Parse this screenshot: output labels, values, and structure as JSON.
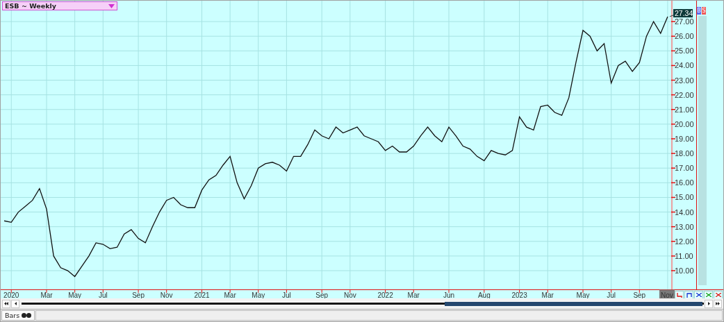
{
  "chart_header": {
    "title": "ESB ~ Weekly"
  },
  "chart": {
    "last_price": "27.34",
    "chart_data": {
      "type": "line",
      "grid": true,
      "ylim": [
        8.77,
        28.33
      ],
      "categories": [
        null,
        "2020",
        null,
        null,
        null,
        null,
        "Mar",
        null,
        null,
        null,
        "May",
        null,
        null,
        null,
        "Jul",
        null,
        null,
        null,
        null,
        "Sep",
        null,
        null,
        null,
        "Nov",
        null,
        null,
        null,
        null,
        "2021",
        null,
        null,
        null,
        "Mar",
        null,
        null,
        null,
        "May",
        null,
        null,
        null,
        "Jul",
        null,
        null,
        null,
        null,
        "Sep",
        null,
        null,
        null,
        "Nov",
        null,
        null,
        null,
        null,
        "2022",
        null,
        null,
        null,
        "Mar",
        null,
        null,
        null,
        null,
        "Jun",
        null,
        null,
        null,
        null,
        "Aug",
        null,
        null,
        null,
        null,
        "2023",
        null,
        null,
        null,
        "Mar",
        null,
        null,
        null,
        null,
        "May",
        null,
        null,
        null,
        "Jul",
        null,
        null,
        null,
        "Sep",
        null,
        null,
        null,
        "Nov"
      ],
      "series": [
        {
          "color": "#111111",
          "values": [
            13.4,
            13.3,
            14.0,
            14.4,
            14.8,
            15.6,
            14.2,
            11.0,
            10.2,
            10.0,
            9.6,
            10.3,
            11.0,
            11.9,
            11.8,
            11.5,
            11.6,
            12.5,
            12.8,
            12.2,
            11.9,
            13.0,
            14.0,
            14.8,
            15.0,
            14.5,
            14.3,
            14.3,
            15.5,
            16.2,
            16.5,
            17.2,
            17.8,
            16.0,
            14.9,
            15.8,
            17.0,
            17.3,
            17.4,
            17.2,
            16.8,
            17.8,
            17.8,
            18.6,
            19.6,
            19.2,
            19.0,
            19.8,
            19.4,
            19.6,
            19.8,
            19.2,
            19.0,
            18.8,
            18.2,
            18.5,
            18.1,
            18.1,
            18.5,
            19.2,
            19.8,
            19.2,
            18.8,
            19.8,
            19.2,
            18.5,
            18.3,
            17.8,
            17.5,
            18.2,
            18.0,
            17.9,
            18.2,
            20.5,
            19.8,
            19.6,
            21.2,
            21.3,
            20.8,
            20.6,
            21.8,
            24.2,
            26.4,
            26.0,
            25.0,
            25.5,
            22.8,
            24.0,
            24.3,
            23.6,
            24.2,
            26.0,
            27.0,
            26.2,
            27.34
          ]
        }
      ],
      "yticks": [
        {
          "value": 10,
          "label": "10.00"
        },
        {
          "value": 11,
          "label": "11.00"
        },
        {
          "value": 12,
          "label": "12.00"
        },
        {
          "value": 13,
          "label": "13.00"
        },
        {
          "value": 14,
          "label": "14.00"
        },
        {
          "value": 15,
          "label": "15.00"
        },
        {
          "value": 16,
          "label": "16.00"
        },
        {
          "value": 17,
          "label": "17.00"
        },
        {
          "value": 18,
          "label": "18.00"
        },
        {
          "value": 19,
          "label": "19.00"
        },
        {
          "value": 20,
          "label": "20.00"
        },
        {
          "value": 21,
          "label": "21.00"
        },
        {
          "value": 22,
          "label": "22.00"
        },
        {
          "value": 23,
          "label": "23.00"
        },
        {
          "value": 24,
          "label": "24.00"
        },
        {
          "value": 25,
          "label": "25.00"
        },
        {
          "value": 26,
          "label": "26.00"
        },
        {
          "value": 27,
          "label": "27.00"
        }
      ]
    }
  },
  "side_buttons": [
    {
      "label": "B",
      "color": "#5a6cf0"
    },
    {
      "label": "S",
      "color": "#f05a5a"
    }
  ],
  "status_bar": {
    "tabs": [
      {
        "label": "Bars"
      }
    ]
  }
}
